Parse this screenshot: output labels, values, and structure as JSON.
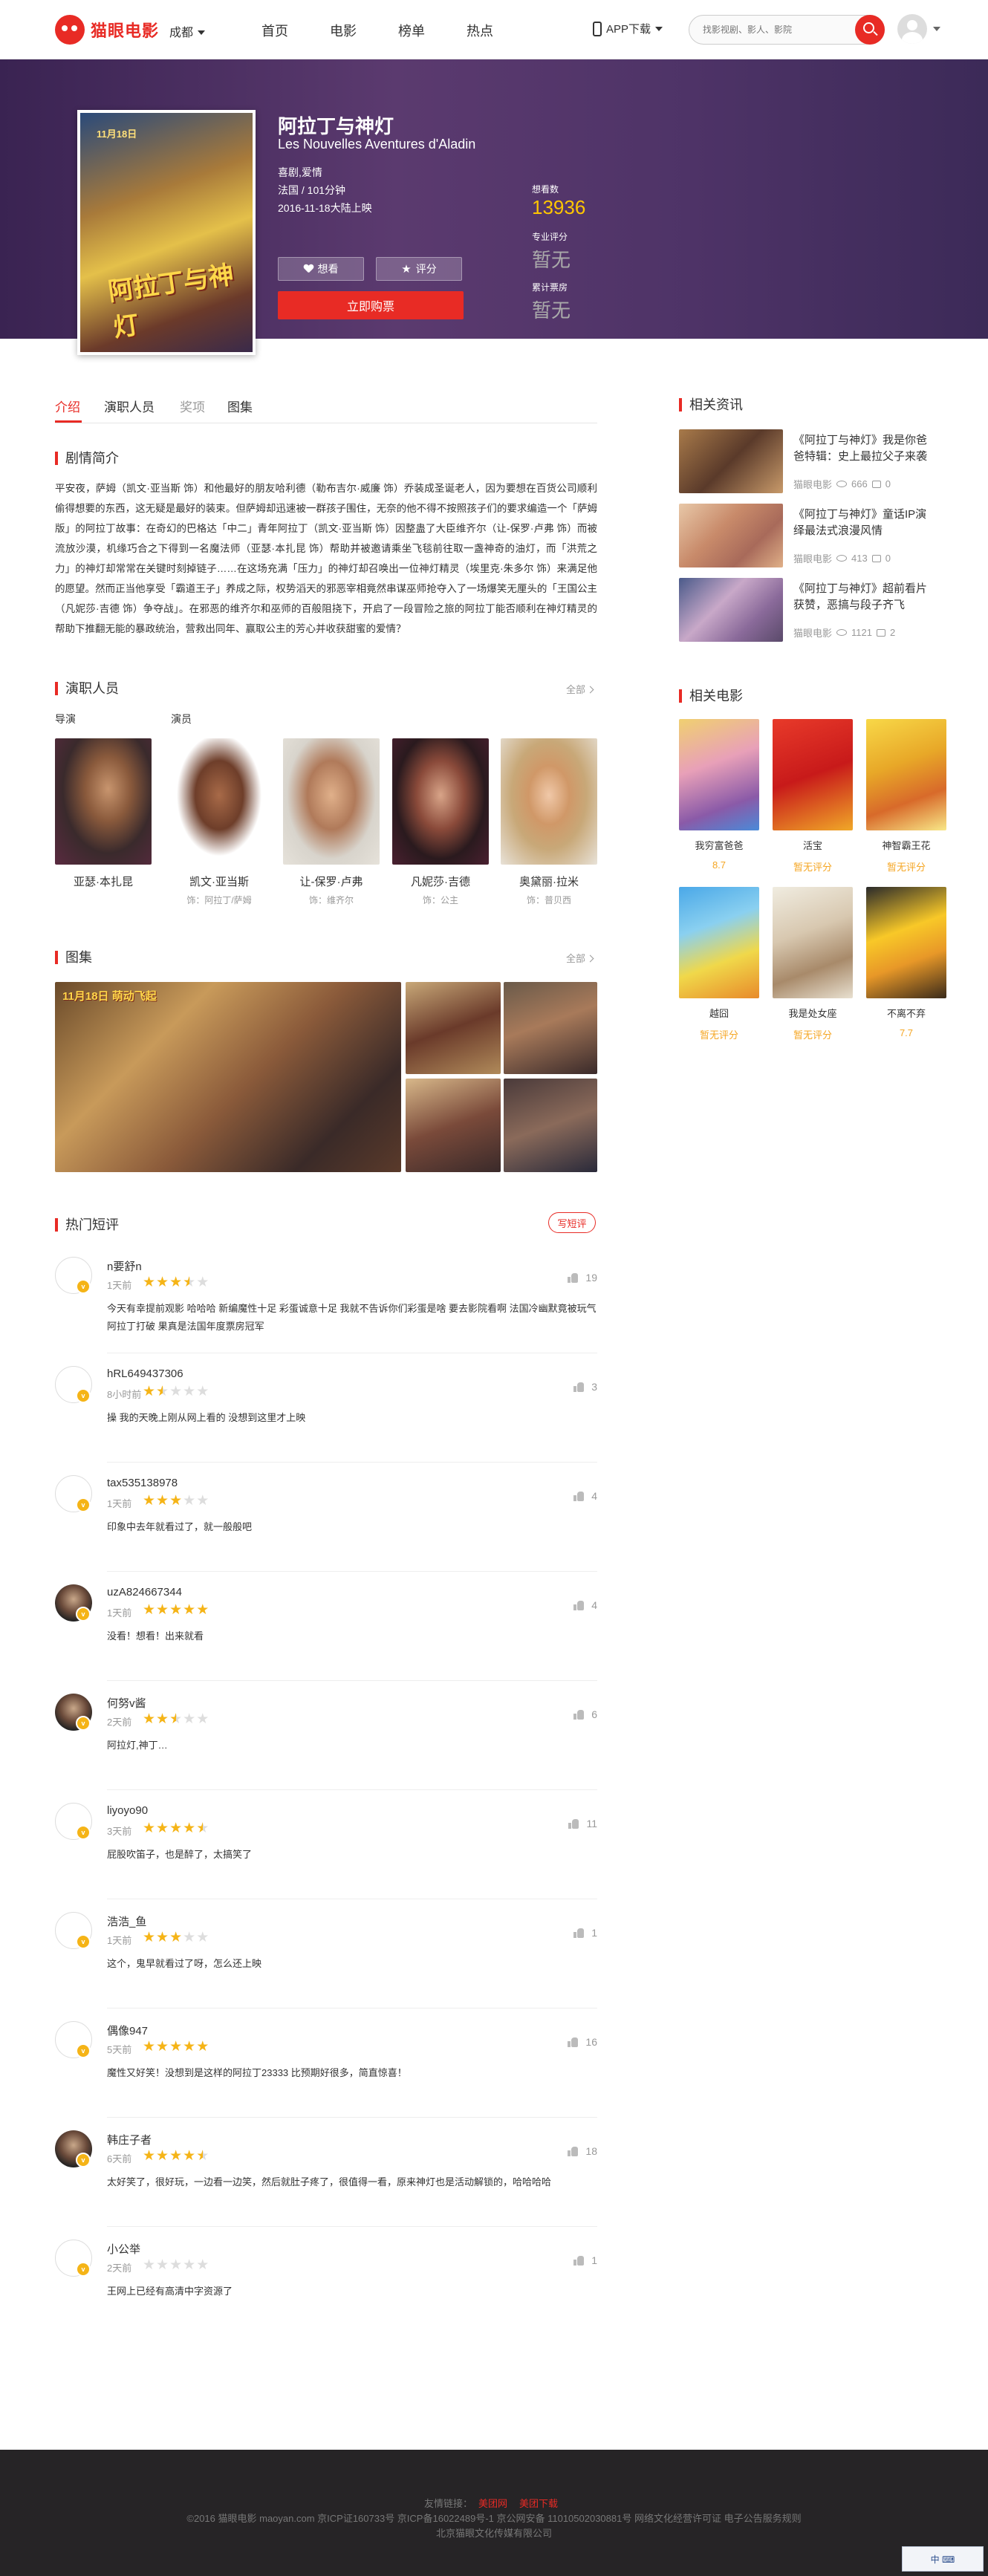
{
  "header": {
    "logo_text": "猫眼电影",
    "city": "成都",
    "nav": [
      "首页",
      "电影",
      "榜单",
      "热点"
    ],
    "app_download": "APP下载",
    "search_placeholder": "找影视剧、影人、影院"
  },
  "movie": {
    "poster_date": "11月18日",
    "poster_title": "阿拉丁与神灯",
    "title": "阿拉丁与神灯",
    "title_en": "Les Nouvelles Aventures d'Aladin",
    "genres": "喜剧,爱情",
    "region_duration": "法国 / 101分钟",
    "release": "2016-11-18大陆上映",
    "want_button": "想看",
    "rate_button": "评分",
    "buy_button": "立即购票",
    "want_label": "想看数",
    "want_count": "13936",
    "pro_label": "专业评分",
    "pro_score": "暂无",
    "box_label": "累计票房",
    "box_value": "暂无"
  },
  "tabs": [
    "介绍",
    "演职人员",
    "奖项",
    "图集"
  ],
  "intro": {
    "heading": "剧情简介",
    "text": "平安夜，萨姆（凯文·亚当斯 饰）和他最好的朋友哈利德（勒布吉尔·威廉 饰）乔装成圣诞老人，因为要想在百货公司顺利偷得想要的东西，这无疑是最好的装束。但萨姆却迅速被一群孩子围住，无奈的他不得不按照孩子们的要求编造一个「萨姆版」的阿拉丁故事：在奇幻的巴格达「中二」青年阿拉丁（凯文·亚当斯 饰）因整蛊了大臣维齐尔（让-保罗·卢弗 饰）而被流放沙漠，机缘巧合之下得到一名魔法师（亚瑟·本扎昆 饰）帮助并被邀请乘坐飞毯前往取一盏神奇的油灯，而「洪荒之力」的神灯却常常在关键时刻掉链子……在这场充满「压力」的神灯却召唤出一位神灯精灵（埃里克·朱多尔 饰）来满足他的愿望。然而正当他享受「霸道王子」养成之际，权势滔天的邪恶宰相竟然串谋巫师抢夺入了一场爆笑无厘头的「王国公主（凡妮莎·吉德 饰）争夺战」。在邪恶的维齐尔和巫师的百般阻挠下，开启了一段冒险之旅的阿拉丁能否顺利在神灯精灵的帮助下推翻无能的暴政统治，营救出同年、赢取公主的芳心并收获甜蜜的爱情？"
  },
  "cast": {
    "heading": "演职人员",
    "more": "全部",
    "director_label": "导演",
    "actor_label": "演员",
    "people": [
      {
        "name": "亚瑟·本扎昆",
        "role": ""
      },
      {
        "name": "凯文·亚当斯",
        "role": "饰：阿拉丁/萨姆"
      },
      {
        "name": "让-保罗·卢弗",
        "role": "饰：维齐尔"
      },
      {
        "name": "凡妮莎·吉德",
        "role": "饰：公主"
      },
      {
        "name": "奥黛丽·拉米",
        "role": "饰：普贝西"
      }
    ]
  },
  "gallery": {
    "heading": "图集",
    "more": "全部",
    "badge": "11月18日 萌动飞起"
  },
  "comments": {
    "heading": "热门短评",
    "write": "写短评",
    "items": [
      {
        "user": "n要舒n",
        "time": "1天前",
        "stars": 3.5,
        "likes": "19",
        "text": "今天有幸提前观影 哈哈哈 新编魔性十足 彩蛋诚意十足 我就不告诉你们彩蛋是啥 要去影院看啊 法国冷幽默竟被玩气阿拉丁打破 果真是法国年度票房冠军"
      },
      {
        "user": "hRL649437306",
        "time": "8小时前",
        "stars": 1.5,
        "likes": "3",
        "text": "操 我的天晚上刚从网上看的 没想到这里才上映"
      },
      {
        "user": "tax535138978",
        "time": "1天前",
        "stars": 3,
        "likes": "4",
        "text": "印象中去年就看过了，就一般般吧"
      },
      {
        "user": "uzA824667344",
        "time": "1天前",
        "stars": 5,
        "likes": "4",
        "text": "没看！想看！出来就看"
      },
      {
        "user": "何努v酱",
        "time": "2天前",
        "stars": 2.5,
        "likes": "6",
        "text": "阿拉灯,神丁…"
      },
      {
        "user": "liyoyo90",
        "time": "3天前",
        "stars": 4.5,
        "likes": "11",
        "text": "屁股吹笛子，也是醉了，太搞笑了"
      },
      {
        "user": "浩浩_鱼",
        "time": "1天前",
        "stars": 3,
        "likes": "1",
        "text": "这个，鬼早就看过了呀，怎么还上映"
      },
      {
        "user": "偶像947",
        "time": "5天前",
        "stars": 5,
        "likes": "16",
        "text": "魔性又好笑！没想到是这样的阿拉丁23333 比预期好很多，简直惊喜！"
      },
      {
        "user": "韩庄子者",
        "time": "6天前",
        "stars": 4.5,
        "likes": "18",
        "text": "太好笑了，很好玩，一边看一边笑，然后就肚子疼了，很值得一看，原来神灯也是活动解锁的，哈哈哈哈"
      },
      {
        "user": "小公举",
        "time": "2天前",
        "stars": 0,
        "likes": "1",
        "text": "王网上已经有高清中字资源了"
      }
    ]
  },
  "news": {
    "heading": "相关资讯",
    "items": [
      {
        "title": "《阿拉丁与神灯》我是你爸爸特辑：史上最拉父子来袭",
        "source": "猫眼电影",
        "views": "666",
        "comments": "0"
      },
      {
        "title": "《阿拉丁与神灯》童话IP演绎最法式浪漫风情",
        "source": "猫眼电影",
        "views": "413",
        "comments": "0"
      },
      {
        "title": "《阿拉丁与神灯》超前看片获赞，恶搞与段子齐飞",
        "source": "猫眼电影",
        "views": "1121",
        "comments": "2"
      }
    ]
  },
  "related": {
    "heading": "相关电影",
    "items": [
      {
        "name": "我穷富爸爸",
        "score": "8.7"
      },
      {
        "name": "活宝",
        "score": "暂无评分"
      },
      {
        "name": "神智霸王花",
        "score": "暂无评分"
      },
      {
        "name": "越囧",
        "score": "暂无评分"
      },
      {
        "name": "我是处女座",
        "score": "暂无评分"
      },
      {
        "name": "不离不弃",
        "score": "7.7"
      }
    ]
  },
  "footer": {
    "links_label": "友情链接：",
    "link1": "美团网",
    "link2": "美团下载",
    "line2": "©2016 猫眼电影 maoyan.com 京ICP证160733号 京ICP备16022489号-1 京公网安备 11010502030881号 网络文化经营许可证 电子公告服务规则",
    "line3": "北京猫眼文化传媒有限公司"
  },
  "ime": "中 ⌨"
}
